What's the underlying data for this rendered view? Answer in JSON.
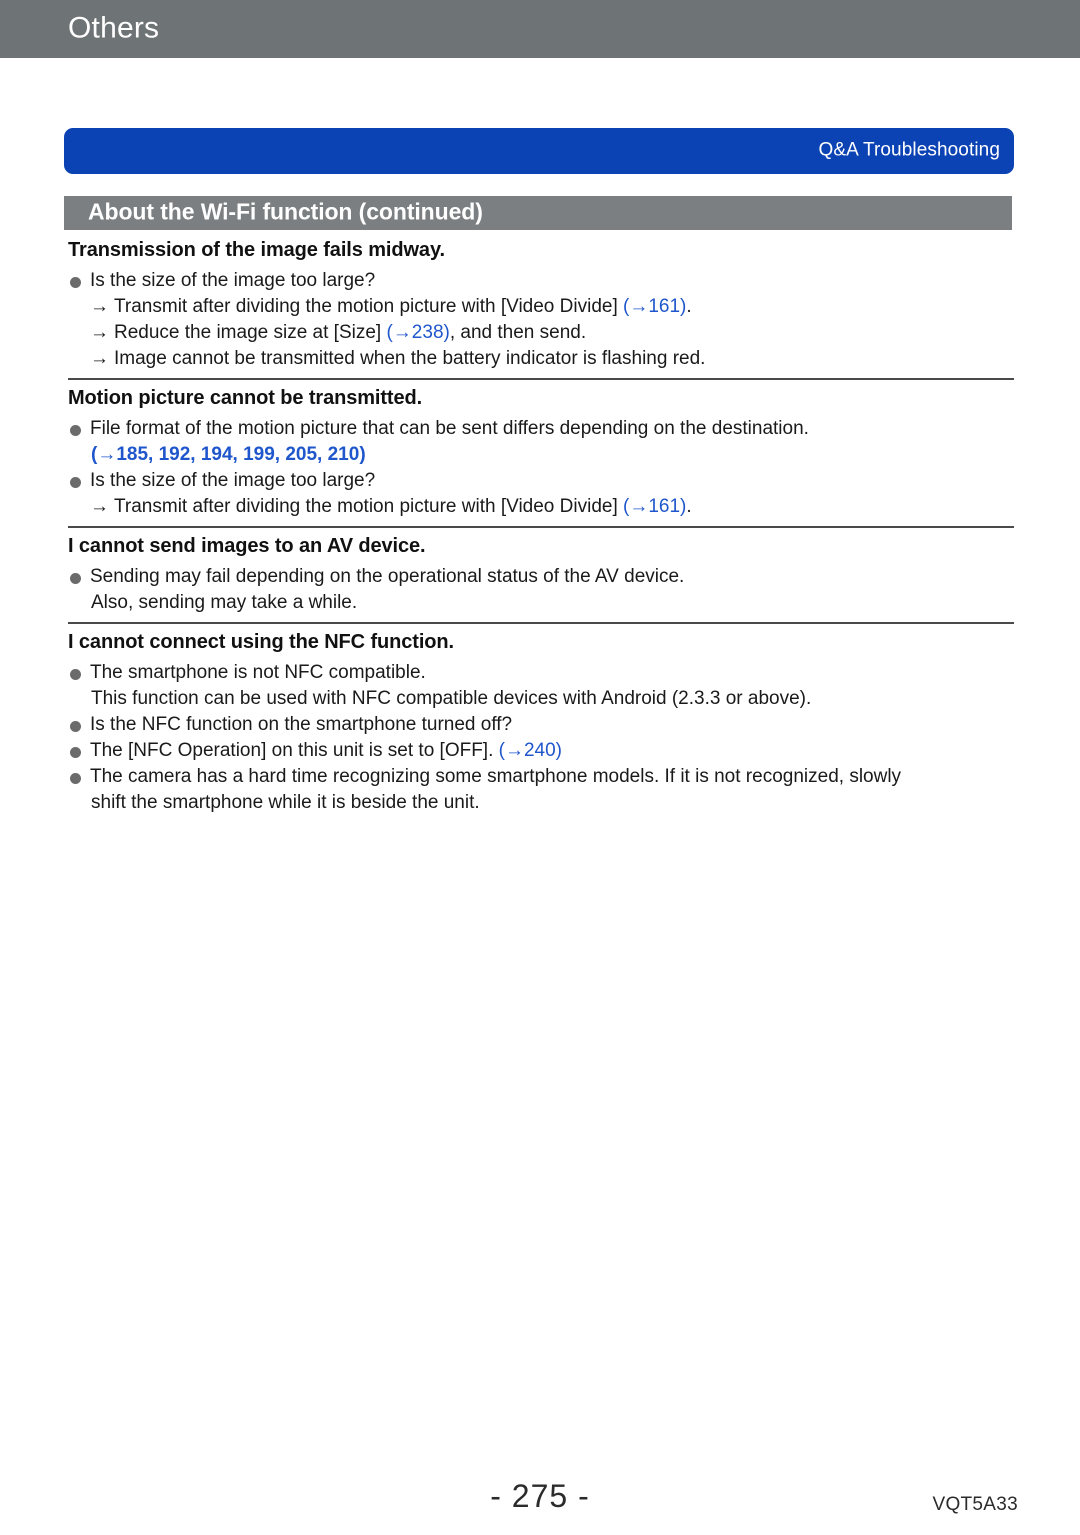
{
  "chapter": {
    "title": "Others"
  },
  "banner": {
    "label": "Q&A  Troubleshooting",
    "color": "#0b43b5"
  },
  "section": {
    "title": "About the Wi-Fi function (continued)",
    "color": "#7b7f81"
  },
  "link_color": "#1f56cc",
  "blocks": [
    {
      "heading": "Transmission of the image fails midway.",
      "lines": [
        {
          "type": "bullet",
          "text": "Is the size of the image too large?"
        },
        {
          "type": "arrow",
          "text": "Transmit after dividing the motion picture with [Video Divide] ",
          "ref": "(→161)",
          "tail": "."
        },
        {
          "type": "arrow",
          "text": "Reduce the image size at [Size] ",
          "ref": "(→238)",
          "tail": ", and then send."
        },
        {
          "type": "arrow",
          "text": "Image cannot be transmitted when the battery indicator is flashing red."
        }
      ]
    },
    {
      "heading": "Motion picture cannot be transmitted.",
      "lines": [
        {
          "type": "bullet",
          "text": "File format of the motion picture that can be sent differs depending on the destination."
        },
        {
          "type": "ref-line",
          "text": "(→185, 192, 194, 199, 205, 210)"
        },
        {
          "type": "bullet",
          "text": "Is the size of the image too large?"
        },
        {
          "type": "arrow",
          "text": "Transmit after dividing the motion picture with [Video Divide] ",
          "ref": "(→161)",
          "tail": "."
        }
      ]
    },
    {
      "heading": "I cannot send images to an AV device.",
      "lines": [
        {
          "type": "bullet",
          "text": "Sending may fail depending on the operational status of the AV device."
        },
        {
          "type": "cont",
          "text": "Also, sending may take a while."
        }
      ]
    },
    {
      "heading": "I cannot connect using the NFC function.",
      "lines": [
        {
          "type": "bullet",
          "text": "The smartphone is not NFC compatible."
        },
        {
          "type": "cont",
          "text": "This function can be used with NFC compatible devices with Android (2.3.3 or above)."
        },
        {
          "type": "bullet",
          "text": "Is the NFC function on the smartphone turned off?"
        },
        {
          "type": "bullet",
          "text": "The [NFC Operation] on this unit is set to [OFF]. ",
          "ref": "(→240)"
        },
        {
          "type": "bullet",
          "text": "The camera has a hard time recognizing some smartphone models. If it is not recognized, slowly"
        },
        {
          "type": "cont",
          "text": "shift the smartphone while it is beside the unit."
        }
      ]
    }
  ],
  "footer": {
    "page_number": "- 275 -",
    "doc_code": "VQT5A33"
  }
}
